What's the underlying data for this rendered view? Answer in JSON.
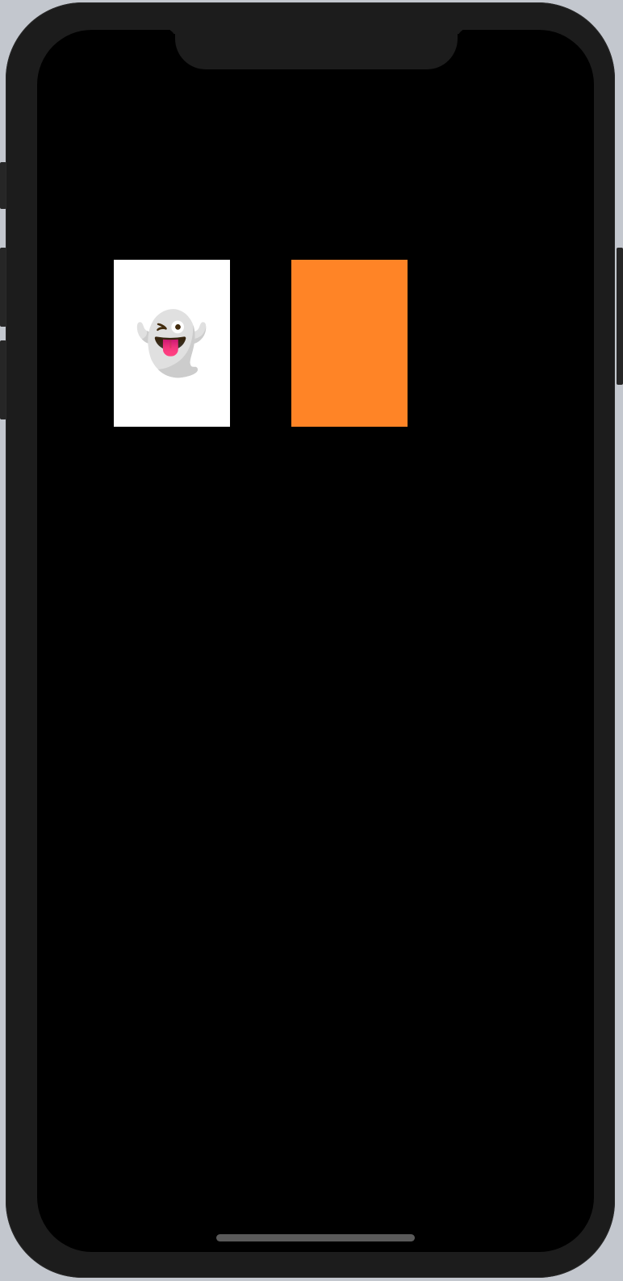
{
  "app": {
    "cards": [
      {
        "state": "face-up",
        "emoji": "👻",
        "background_color": "#ffffff"
      },
      {
        "state": "face-down",
        "emoji": "",
        "background_color": "#ff8426"
      }
    ]
  },
  "theme": {
    "screen_background": "#000000",
    "device_frame": "#1c1c1c",
    "home_indicator": "#5a5a5a"
  }
}
